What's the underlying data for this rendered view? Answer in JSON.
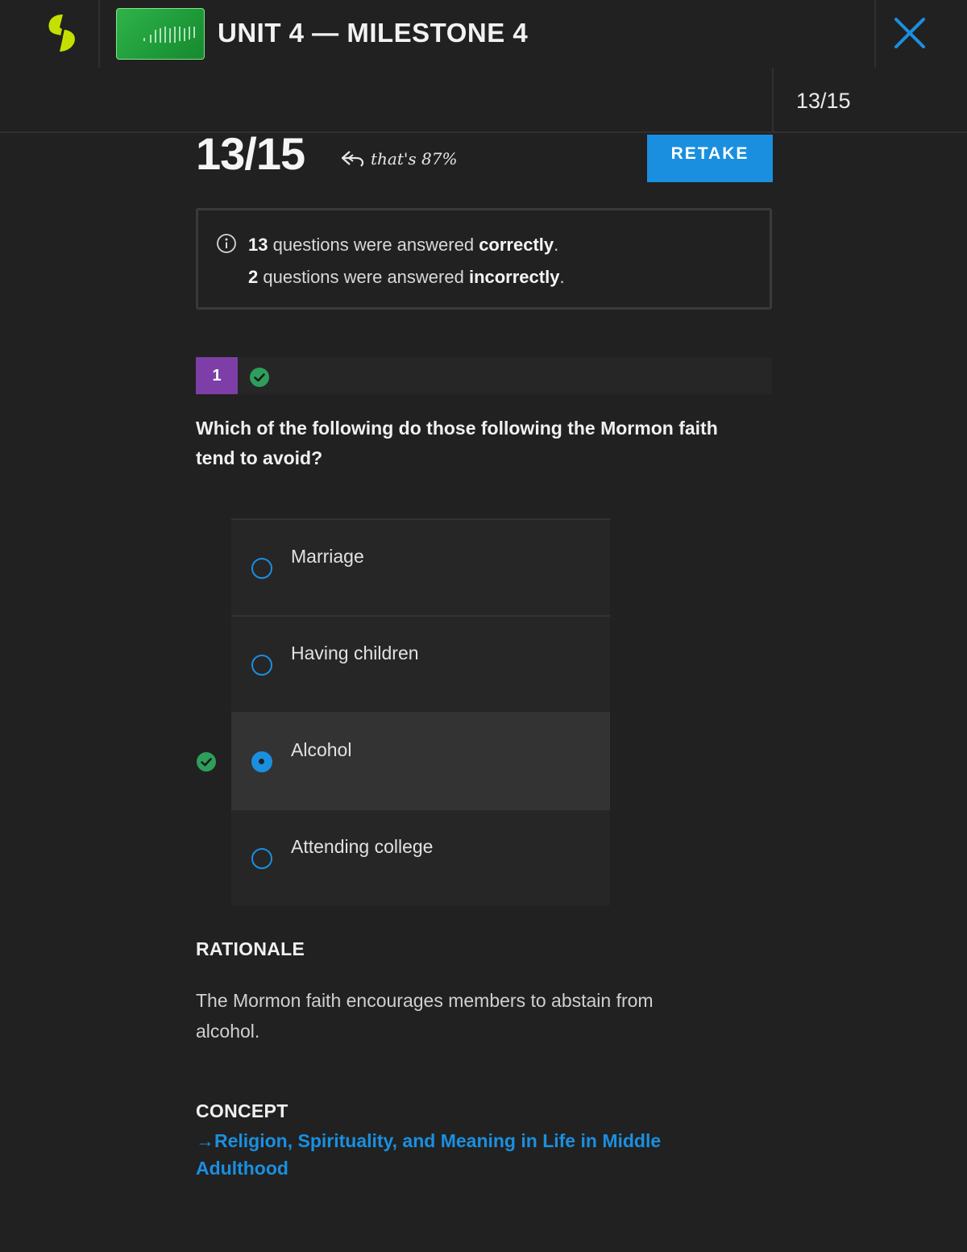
{
  "header": {
    "unit_title": "UNIT 4 — MILESTONE 4",
    "progress": "13/15"
  },
  "score": {
    "big": "13/15",
    "percent_note": "that's 87%",
    "retake_label": "RETAKE"
  },
  "summary": {
    "correct_count": "13",
    "correct_text": " questions were answered ",
    "correct_word": "correctly",
    "incorrect_count": "2",
    "incorrect_text": " questions were answered ",
    "incorrect_word": "incorrectly",
    "period": "."
  },
  "question": {
    "number": "1",
    "status": "correct",
    "text": "Which of the following do those following the Mormon faith tend to avoid?",
    "options": [
      {
        "label": "Marriage",
        "selected": false
      },
      {
        "label": "Having children",
        "selected": false
      },
      {
        "label": "Alcohol",
        "selected": true,
        "correct": true
      },
      {
        "label": "Attending college",
        "selected": false
      }
    ]
  },
  "rationale": {
    "title": "RATIONALE",
    "text": "The Mormon faith encourages members to abstain from alcohol."
  },
  "concept": {
    "title": "CONCEPT",
    "arrow": "→",
    "link": "Religion, Spirituality, and Meaning in Life in Middle Adulthood"
  },
  "colors": {
    "accent": "#1a8fe0",
    "correct_green": "#2e9e5b",
    "question_badge": "#7d3fa7",
    "logo": "#c5e000"
  },
  "icons": [
    "logo-icon",
    "close-icon",
    "info-icon",
    "check-circle-icon",
    "reply-arrow-icon",
    "arrow-right-icon"
  ]
}
